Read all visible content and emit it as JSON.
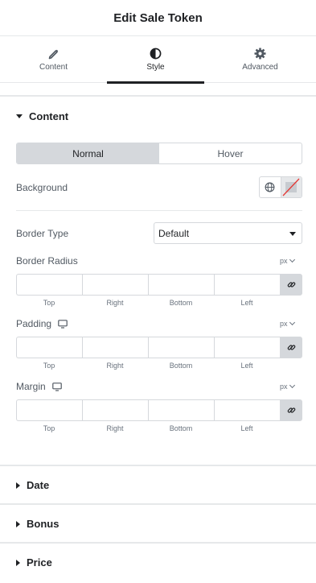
{
  "header": {
    "title": "Edit Sale Token"
  },
  "tabs": [
    {
      "label": "Content",
      "icon": "pencil-icon"
    },
    {
      "label": "Style",
      "icon": "contrast-icon"
    },
    {
      "label": "Advanced",
      "icon": "gear-icon"
    }
  ],
  "content_section": {
    "title": "Content",
    "state_switch": {
      "normal": "Normal",
      "hover": "Hover",
      "active": "Normal"
    },
    "background": {
      "label": "Background",
      "icons": [
        "globe-icon",
        "no-color-swatch-icon"
      ]
    },
    "border_type": {
      "label": "Border Type",
      "value": "Default"
    },
    "border_radius": {
      "label": "Border Radius",
      "unit": "px"
    },
    "padding": {
      "label": "Padding",
      "unit": "px",
      "icon": "desktop-icon"
    },
    "margin": {
      "label": "Margin",
      "unit": "px",
      "icon": "desktop-icon"
    },
    "dimension_labels": [
      "Top",
      "Right",
      "Bottom",
      "Left"
    ]
  },
  "collapsed_sections": [
    {
      "title": "Date"
    },
    {
      "title": "Bonus"
    },
    {
      "title": "Price"
    }
  ],
  "colors": {
    "active_tab": "#1f2124",
    "border": "#d5d8dc",
    "switch_active_bg": "#d5d8dc",
    "swatch_slash": "#e53935"
  }
}
